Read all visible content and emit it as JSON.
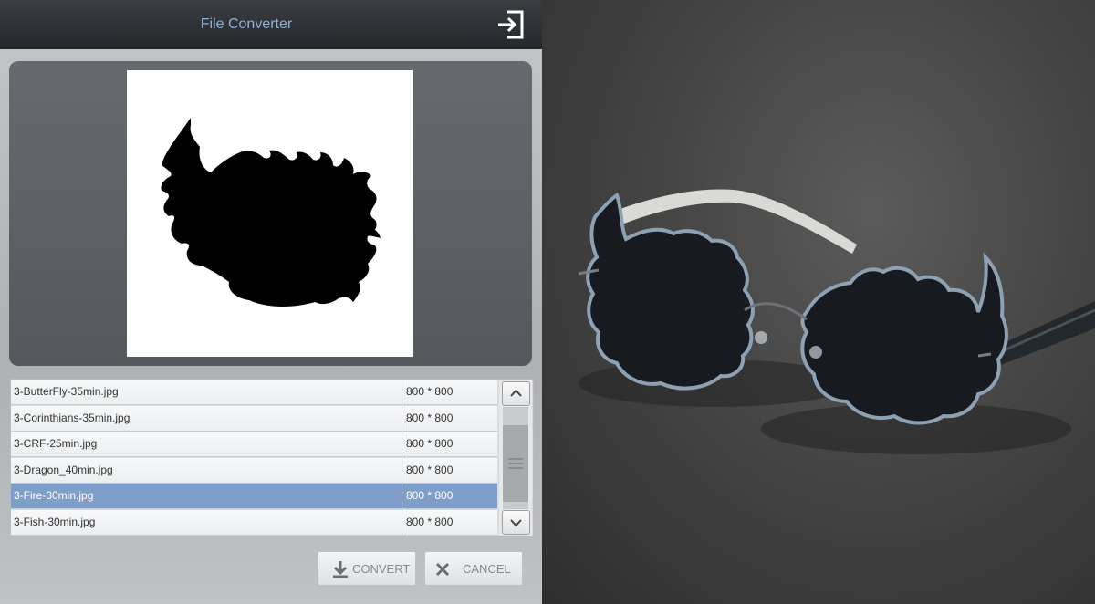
{
  "app": {
    "title": "File Converter",
    "exit_icon": "exit-icon"
  },
  "files": [
    {
      "name": "3-ButterFly-35min.jpg",
      "size": "800 * 800",
      "selected": false
    },
    {
      "name": "3-Corinthians-35min.jpg",
      "size": "800 * 800",
      "selected": false
    },
    {
      "name": "3-CRF-25min.jpg",
      "size": "800 * 800",
      "selected": false
    },
    {
      "name": "3-Dragon_40min.jpg",
      "size": "800 * 800",
      "selected": false
    },
    {
      "name": "3-Fire-30min.jpg",
      "size": "800 * 800",
      "selected": true
    },
    {
      "name": "3-Fish-30min.jpg",
      "size": "800 * 800",
      "selected": false
    }
  ],
  "buttons": {
    "convert": "CONVERT",
    "cancel": "CANCEL"
  },
  "colors": {
    "title": "#8fb1d4",
    "selected_row": "#7f9ec9"
  }
}
